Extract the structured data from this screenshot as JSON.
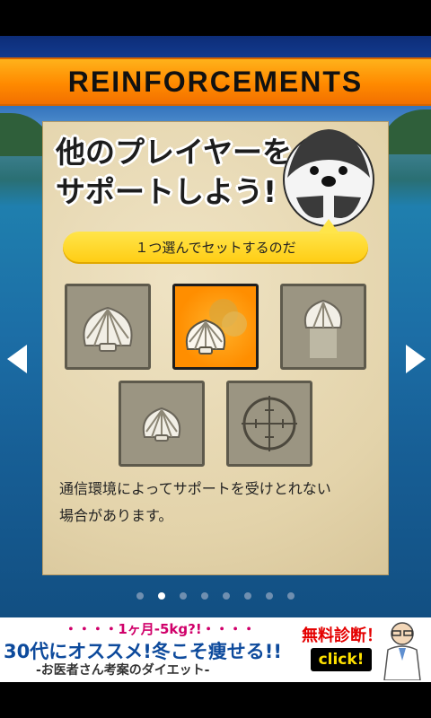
{
  "header": {
    "title": "REINFORCEMENTS"
  },
  "card": {
    "headline_line1": "他のプレイヤーを",
    "headline_line2": "サポートしよう!",
    "instruction": "１つ選んでセットするのだ",
    "description_line1": "通信環境によってサポートを受けとれない",
    "description_line2": "場合があります。",
    "options": [
      {
        "icon": "shell-icon",
        "selected": false
      },
      {
        "icon": "shell-boost-icon",
        "selected": true
      },
      {
        "icon": "shell-fade-icon",
        "selected": false
      },
      {
        "icon": "shell-small-icon",
        "selected": false
      },
      {
        "icon": "crosshair-icon",
        "selected": false
      }
    ]
  },
  "pager": {
    "page_count": 8,
    "current_page": 2
  },
  "ad": {
    "line1": "・・・・1ヶ月-5kg?!・・・・",
    "line2": "30代にオススメ!冬こそ痩せる!!",
    "line3": "-お医者さん考案のダイエット-",
    "badge": "無料診断！",
    "cta": "click!"
  },
  "colors": {
    "banner": "#ff8a00",
    "selected_slot": "#ff9a10",
    "speech_bubble": "#ffd21e",
    "panel": "#e6d7b0"
  }
}
